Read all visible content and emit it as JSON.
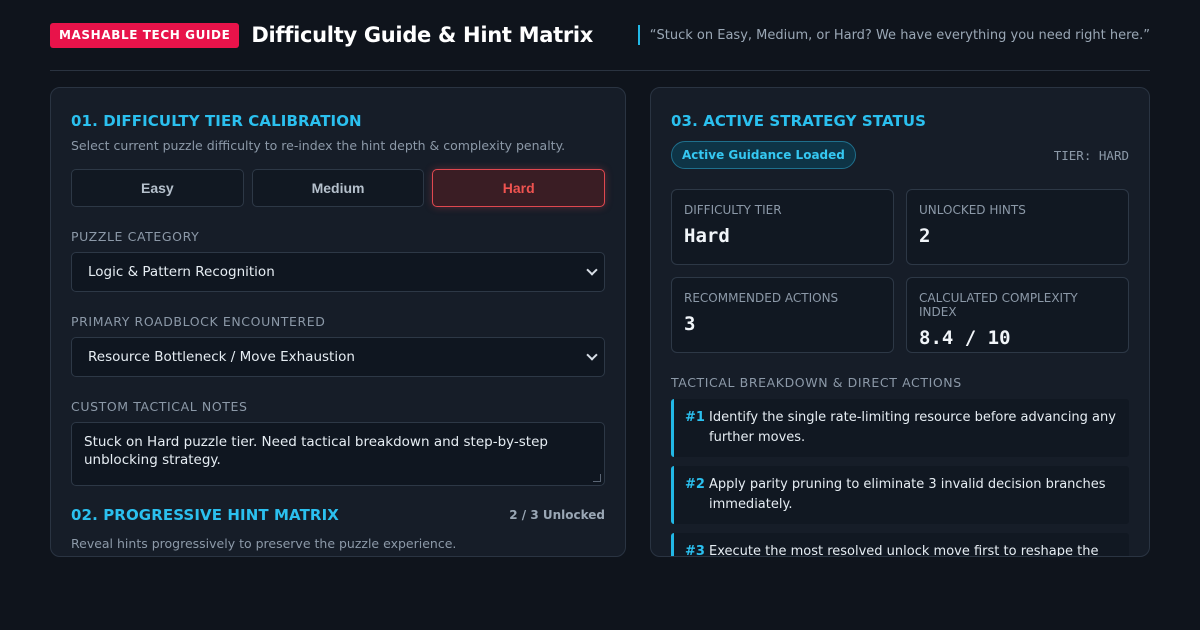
{
  "header": {
    "badge": "MASHABLE TECH GUIDE",
    "title": "Difficulty Guide & Hint Matrix",
    "tagline": "“Stuck on Easy, Medium, or Hard? We have everything you need right here.”"
  },
  "calibration": {
    "title": "01. DIFFICULTY TIER CALIBRATION",
    "description": "Select current puzzle difficulty to re-index the hint depth & complexity penalty.",
    "buttons": [
      {
        "label": "Easy"
      },
      {
        "label": "Medium"
      },
      {
        "label": "Hard"
      }
    ],
    "selected": "Hard",
    "category_label": "PUZZLE CATEGORY",
    "category_value": "Logic & Pattern Recognition",
    "roadblock_label": "PRIMARY ROADBLOCK ENCOUNTERED",
    "roadblock_value": "Resource Bottleneck / Move Exhaustion",
    "notes_label": "CUSTOM TACTICAL NOTES",
    "notes_value": "Stuck on Hard puzzle tier. Need tactical breakdown and step-by-step unblocking strategy."
  },
  "hints": {
    "title": "02. PROGRESSIVE HINT MATRIX",
    "unlocked": "2 / 3 Unlocked",
    "description": "Reveal hints progressively to preserve the puzzle experience."
  },
  "status": {
    "title": "03. ACTIVE STRATEGY STATUS",
    "pill": "Active Guidance Loaded",
    "tier_readout": "TIER: HARD",
    "stats": [
      {
        "label": "DIFFICULTY TIER",
        "value": "Hard"
      },
      {
        "label": "UNLOCKED HINTS",
        "value": "2"
      },
      {
        "label": "RECOMMENDED ACTIONS",
        "value": "3"
      },
      {
        "label": "CALCULATED COMPLEXITY INDEX",
        "value": "8.4 / 10"
      }
    ],
    "breakdown_label": "TACTICAL BREAKDOWN & DIRECT ACTIONS",
    "actions": [
      {
        "num": "#1",
        "text": "Identify the single rate-limiting resource before advancing any further moves."
      },
      {
        "num": "#2",
        "text": "Apply parity pruning to eliminate 3 invalid decision branches immediately."
      },
      {
        "num": "#3",
        "text": "Execute the most resolved unlock move first to reshape the control path."
      }
    ]
  },
  "colors": {
    "accent": "#2bc0ef",
    "brand": "#e8134a",
    "hard": "#ef5350",
    "background": "#0f141c"
  }
}
